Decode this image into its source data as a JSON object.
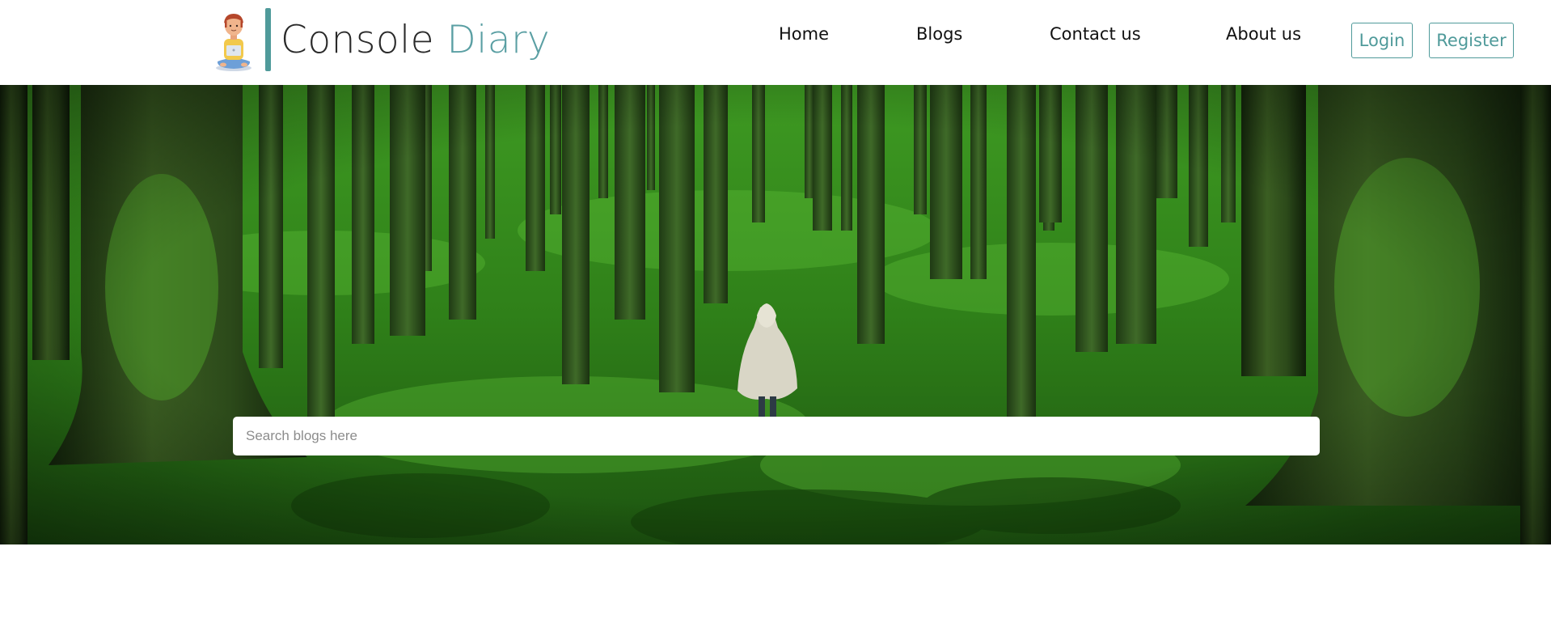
{
  "brand": {
    "name_main": "Console",
    "name_accent": "Diary",
    "accent_color": "#5a9fa3",
    "logo_icon": "person-with-laptop-icon"
  },
  "nav": {
    "links": [
      "Home",
      "Blogs",
      "Contact us",
      "About us"
    ],
    "login_label": "Login",
    "register_label": "Register"
  },
  "hero": {
    "image": "forest-hooded-figure-image"
  },
  "search": {
    "placeholder": "Search blogs here",
    "value": ""
  },
  "colors": {
    "teal": "#4f9a9a",
    "forest_green": "#2f7a1c"
  }
}
